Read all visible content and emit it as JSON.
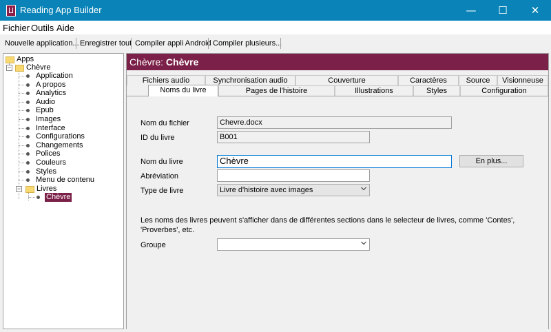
{
  "window": {
    "title": "Reading App Builder",
    "minimize": "—",
    "maximize": "☐",
    "close": "✕"
  },
  "menu": {
    "file": "Fichier",
    "tools": "Outils",
    "help": "Aide"
  },
  "toolbar": {
    "new_app": "Nouvelle application...",
    "save_all": "Enregistrer tout",
    "build_android": "Compiler appli Android",
    "build_many": "Compiler plusieurs..."
  },
  "tree": {
    "apps": "Apps",
    "app": "Chèvre",
    "items": [
      "Application",
      "A propos",
      "Analytics",
      "Audio",
      "Epub",
      "Images",
      "Interface",
      "Configurations",
      "Changements",
      "Polices",
      "Couleurs",
      "Styles",
      "Menu de contenu"
    ],
    "books": "Livres",
    "book": "Chèvre"
  },
  "header": {
    "prefix": "Chèvre:",
    "name": "Chèvre"
  },
  "tabs": {
    "row1": [
      "Fichiers audio",
      "Synchronisation audio",
      "Couverture",
      "Caractères",
      "Source",
      "Visionneuse"
    ],
    "row2": [
      "Noms du livre",
      "Pages de l'histoire",
      "Illustrations",
      "Styles",
      "Configuration"
    ]
  },
  "form": {
    "filename_label": "Nom du fichier",
    "filename_value": "Chevre.docx",
    "bookid_label": "ID du livre",
    "bookid_value": "B001",
    "bookname_label": "Nom du livre",
    "bookname_value": "Chèvre",
    "more_button": "En plus...",
    "abbrev_label": "Abréviation",
    "abbrev_value": "",
    "type_label": "Type de livre",
    "type_value": "Livre d'histoire avec images",
    "help_line1": "Les noms des livres peuvent s'afficher dans de différentes sections dans le selecteur de livres, comme 'Contes',",
    "help_line2": "'Proverbes', etc.",
    "group_label": "Groupe",
    "group_value": ""
  },
  "colors": {
    "titlebar": "#0a84b8",
    "accent": "#7b2048"
  }
}
